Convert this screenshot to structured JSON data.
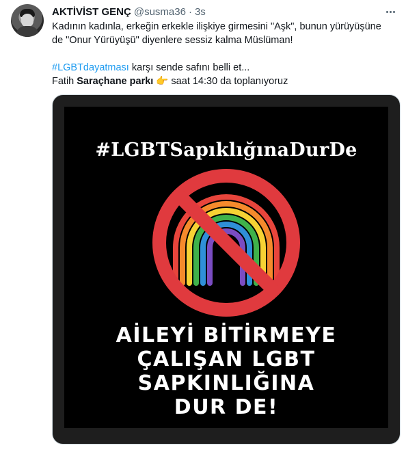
{
  "tweet": {
    "author_name": "AKTİVİST GENÇ",
    "author_handle": "@susma36",
    "separator": "·",
    "time": "3s",
    "line1": "Kadının kadınla, erkeğin erkekle ilişkiye girmesini \"Aşk\", bunun yürüyüşüne",
    "line2": "de \"Onur Yürüyüşü\" diyenlere sessiz kalma Müslüman!",
    "hashtag": "#LGBTdayatması",
    "line3_rest": " karşı sende safını belli et...",
    "line4_pre": "Fatih ",
    "line4_bold": "Saraçhane parkı",
    "line4_emoji": "👉",
    "line4_post": " saat 14:30 da toplanıyoruz"
  },
  "poster": {
    "hashtag": "#LGBTSapıklığınaDurDe",
    "slogan_lines": [
      "AİLEYİ BİTİRMEYE",
      "ÇALIŞAN LGBT",
      "SAPKINLIĞINA",
      "DUR DE!"
    ],
    "colors": {
      "background": "#000000",
      "prohibition": "#e03a3e",
      "rainbow": [
        "#e8453c",
        "#f58a2c",
        "#f7d234",
        "#3fb24a",
        "#2f8fd8",
        "#7a4cc2"
      ]
    }
  },
  "icons": {
    "more": "more-horizontal-icon",
    "avatar": "avatar",
    "pointing": "pointing-right-emoji"
  }
}
